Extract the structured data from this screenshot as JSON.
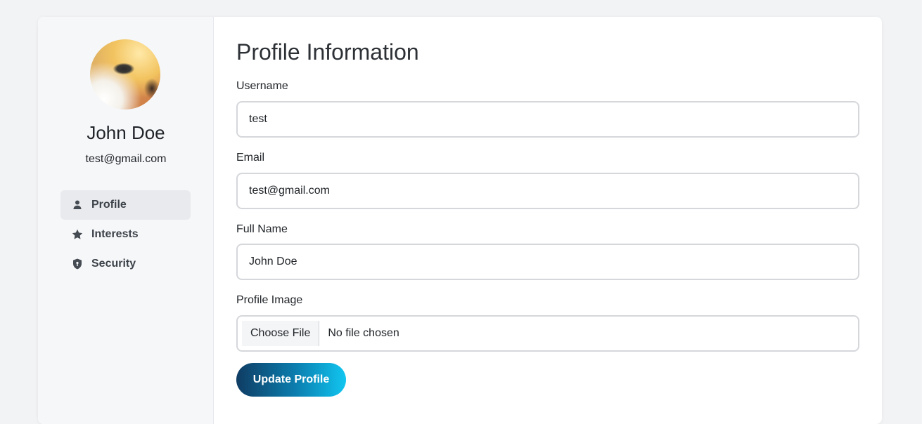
{
  "profile": {
    "name": "John Doe",
    "email": "test@gmail.com"
  },
  "sidebar": {
    "items": [
      {
        "label": "Profile",
        "icon": "user-icon",
        "active": true
      },
      {
        "label": "Interests",
        "icon": "star-icon",
        "active": false
      },
      {
        "label": "Security",
        "icon": "shield-icon",
        "active": false
      }
    ]
  },
  "main": {
    "title": "Profile Information",
    "fields": {
      "username": {
        "label": "Username",
        "value": "test"
      },
      "email": {
        "label": "Email",
        "value": "test@gmail.com"
      },
      "full_name": {
        "label": "Full Name",
        "value": "John Doe"
      },
      "profile_image": {
        "label": "Profile Image",
        "button": "Choose File",
        "status": "No file chosen"
      }
    },
    "submit_label": "Update Profile"
  },
  "colors": {
    "accent_start": "#0f3c63",
    "accent_end": "#11c6f0",
    "sidebar_bg": "#f6f7f9",
    "active_item_bg": "#e8eaed"
  }
}
